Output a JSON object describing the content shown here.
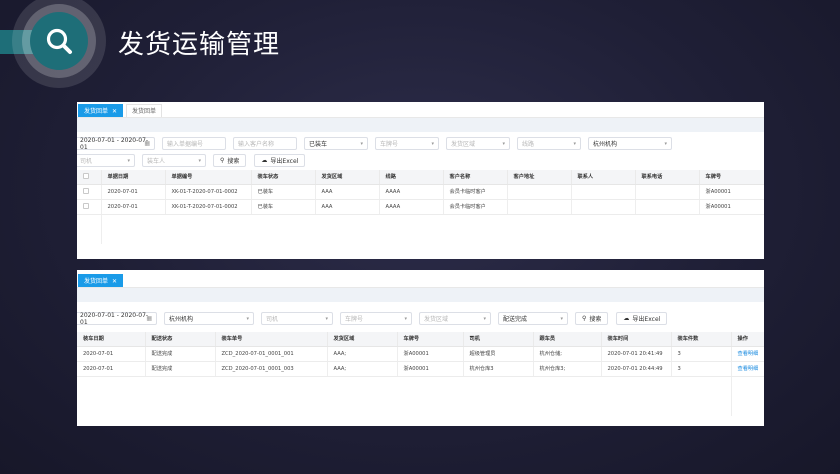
{
  "page": {
    "title": "发货运输管理"
  },
  "panel1": {
    "tabs": [
      {
        "label": "发货回单",
        "active": true,
        "closable": true
      },
      {
        "label": "发货回单",
        "active": false,
        "closable": false
      }
    ],
    "filters": {
      "date_range": "2020-07-01 - 2020-07-01",
      "order_no_placeholder": "输入单据编号",
      "customer_placeholder": "输入客户名称",
      "status_value": "已装车",
      "plate_placeholder": "车牌号",
      "ship_area_placeholder": "发货区域",
      "route_placeholder": "线路",
      "org_value": "杭州机构",
      "driver_placeholder": "司机",
      "loader_placeholder": "装车人",
      "search_label": "搜索",
      "export_label": "导出Excel"
    },
    "columns": [
      "单据日期",
      "单据编号",
      "装车状态",
      "发货区域",
      "线路",
      "客户名称",
      "客户地址",
      "联系人",
      "联系电话",
      "车牌号"
    ],
    "rows": [
      [
        "2020-07-01",
        "XK-01-T-2020-07-01-0002",
        "已装车",
        "AAA",
        "AAAA",
        "会员卡临时客户",
        "",
        "",
        "",
        "浙A00001"
      ],
      [
        "2020-07-01",
        "XK-01-T-2020-07-01-0002",
        "已装车",
        "AAA",
        "AAAA",
        "会员卡临时客户",
        "",
        "",
        "",
        "浙A00001"
      ]
    ]
  },
  "panel2": {
    "tabs": [
      {
        "label": "发货回单",
        "active": true,
        "closable": true
      }
    ],
    "filters": {
      "date_range": "2020-07-01 - 2020-07-01",
      "org_value": "杭州机构",
      "driver_placeholder": "司机",
      "plate_placeholder": "车牌号",
      "ship_area_placeholder": "发货区域",
      "status_value": "配送完成",
      "search_label": "搜索",
      "export_label": "导出Excel"
    },
    "columns": [
      "装车日期",
      "配送状态",
      "装车单号",
      "发货区域",
      "车牌号",
      "司机",
      "跟车员",
      "装车时间",
      "装车件数",
      "操作"
    ],
    "rows": [
      [
        "2020-07-01",
        "配送完成",
        "ZCD_2020-07-01_0001_001",
        "AAA;",
        "浙A00001",
        "超级管理员",
        "杭州仓储;",
        "2020-07-01 20:41:49",
        "3",
        "查看明细"
      ],
      [
        "2020-07-01",
        "配送完成",
        "ZCD_2020-07-01_0001_003",
        "AAA;",
        "浙A00001",
        "杭州仓库3",
        "杭州仓库3;",
        "2020-07-01 20:44:49",
        "3",
        "查看明细"
      ]
    ]
  }
}
